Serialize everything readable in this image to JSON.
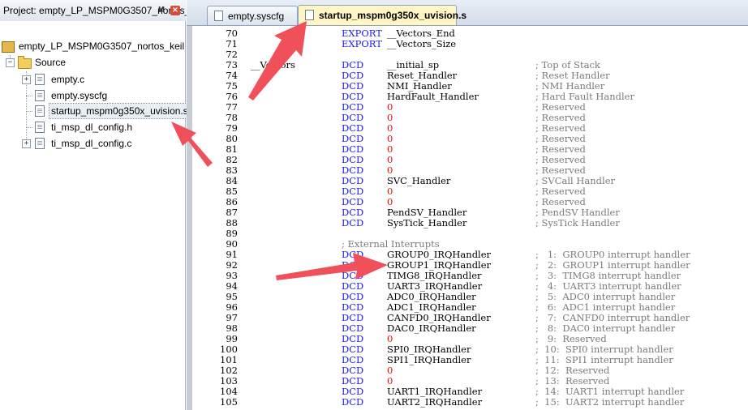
{
  "project_panel": {
    "project_title": "Project: empty_LP_MSPM0G3507_nortos_k",
    "pin_label": "И",
    "close_label": "×",
    "target_name": "empty_LP_MSPM0G3507_nortos_keil",
    "group_name": "Source",
    "files": [
      {
        "name": "empty.c"
      },
      {
        "name": "empty.syscfg"
      },
      {
        "name": "startup_mspm0g350x_uvision.s"
      },
      {
        "name": "ti_msp_dl_config.h"
      },
      {
        "name": "ti_msp_dl_config.c"
      }
    ]
  },
  "tabs": [
    {
      "label": "empty.syscfg",
      "active": false
    },
    {
      "label": "startup_mspm0g350x_uvision.s",
      "active": true
    }
  ],
  "code_lines": [
    {
      "n": "70",
      "label": "",
      "op": "EXPORT",
      "arg": "__Vectors_End",
      "comment": ""
    },
    {
      "n": "71",
      "label": "",
      "op": "EXPORT",
      "arg": "__Vectors_Size",
      "comment": ""
    },
    {
      "n": "72",
      "label": "",
      "op": "",
      "arg": "",
      "comment": ""
    },
    {
      "n": "73",
      "label": "__Vectors",
      "op": "DCD",
      "arg": "__initial_sp",
      "comment": "; Top of Stack"
    },
    {
      "n": "74",
      "label": "",
      "op": "DCD",
      "arg": "Reset_Handler",
      "comment": "; Reset Handler"
    },
    {
      "n": "75",
      "label": "",
      "op": "DCD",
      "arg": "NMI_Handler",
      "comment": "; NMI Handler"
    },
    {
      "n": "76",
      "label": "",
      "op": "DCD",
      "arg": "HardFault_Handler",
      "comment": "; Hard Fault Handler"
    },
    {
      "n": "77",
      "label": "",
      "op": "DCD",
      "arg": "0",
      "comment": "; Reserved"
    },
    {
      "n": "78",
      "label": "",
      "op": "DCD",
      "arg": "0",
      "comment": "; Reserved"
    },
    {
      "n": "79",
      "label": "",
      "op": "DCD",
      "arg": "0",
      "comment": "; Reserved"
    },
    {
      "n": "80",
      "label": "",
      "op": "DCD",
      "arg": "0",
      "comment": "; Reserved"
    },
    {
      "n": "81",
      "label": "",
      "op": "DCD",
      "arg": "0",
      "comment": "; Reserved"
    },
    {
      "n": "82",
      "label": "",
      "op": "DCD",
      "arg": "0",
      "comment": "; Reserved"
    },
    {
      "n": "83",
      "label": "",
      "op": "DCD",
      "arg": "0",
      "comment": "; Reserved"
    },
    {
      "n": "84",
      "label": "",
      "op": "DCD",
      "arg": "SVC_Handler",
      "comment": "; SVCall Handler"
    },
    {
      "n": "85",
      "label": "",
      "op": "DCD",
      "arg": "0",
      "comment": "; Reserved"
    },
    {
      "n": "86",
      "label": "",
      "op": "DCD",
      "arg": "0",
      "comment": "; Reserved"
    },
    {
      "n": "87",
      "label": "",
      "op": "DCD",
      "arg": "PendSV_Handler",
      "comment": "; PendSV Handler"
    },
    {
      "n": "88",
      "label": "",
      "op": "DCD",
      "arg": "SysTick_Handler",
      "comment": "; SysTick Handler"
    },
    {
      "n": "89",
      "label": "",
      "op": "",
      "arg": "",
      "comment": ""
    },
    {
      "n": "90",
      "label": "",
      "op": "; External Interrupts",
      "arg": "",
      "comment": ""
    },
    {
      "n": "91",
      "label": "",
      "op": "DCD",
      "arg": "GROUP0_IRQHandler",
      "comment": ";   1:  GROUP0 interrupt handler"
    },
    {
      "n": "92",
      "label": "",
      "op": "DCD",
      "arg": "GROUP1_IRQHandler",
      "comment": ";   2:  GROUP1 interrupt handler"
    },
    {
      "n": "93",
      "label": "",
      "op": "DCD",
      "arg": "TIMG8_IRQHandler",
      "comment": ";   3:  TIMG8 interrupt handler"
    },
    {
      "n": "94",
      "label": "",
      "op": "DCD",
      "arg": "UART3_IRQHandler",
      "comment": ";   4:  UART3 interrupt handler"
    },
    {
      "n": "95",
      "label": "",
      "op": "DCD",
      "arg": "ADC0_IRQHandler",
      "comment": ";   5:  ADC0 interrupt handler"
    },
    {
      "n": "96",
      "label": "",
      "op": "DCD",
      "arg": "ADC1_IRQHandler",
      "comment": ";   6:  ADC1 interrupt handler"
    },
    {
      "n": "97",
      "label": "",
      "op": "DCD",
      "arg": "CANFD0_IRQHandler",
      "comment": ";   7:  CANFD0 interrupt handler"
    },
    {
      "n": "98",
      "label": "",
      "op": "DCD",
      "arg": "DAC0_IRQHandler",
      "comment": ";   8:  DAC0 interrupt handler"
    },
    {
      "n": "99",
      "label": "",
      "op": "DCD",
      "arg": "0",
      "comment": ";   9:  Reserved"
    },
    {
      "n": "100",
      "label": "",
      "op": "DCD",
      "arg": "SPI0_IRQHandler",
      "comment": ";  10:  SPI0 interrupt handler"
    },
    {
      "n": "101",
      "label": "",
      "op": "DCD",
      "arg": "SPI1_IRQHandler",
      "comment": ";  11:  SPI1 interrupt handler"
    },
    {
      "n": "102",
      "label": "",
      "op": "DCD",
      "arg": "0",
      "comment": ";  12:  Reserved"
    },
    {
      "n": "103",
      "label": "",
      "op": "DCD",
      "arg": "0",
      "comment": ";  13:  Reserved"
    },
    {
      "n": "104",
      "label": "",
      "op": "DCD",
      "arg": "UART1_IRQHandler",
      "comment": ";  14:  UART1 interrupt handler"
    },
    {
      "n": "105",
      "label": "",
      "op": "DCD",
      "arg": "UART2_IRQHandler",
      "comment": ";  15:  UART2 interrupt handler"
    }
  ],
  "colors": {
    "keyword": "#1a1af0",
    "number": "#e01010",
    "comment": "#7a7a7a",
    "arrow": "#f0505a",
    "active_tab": "#fff6c4"
  }
}
